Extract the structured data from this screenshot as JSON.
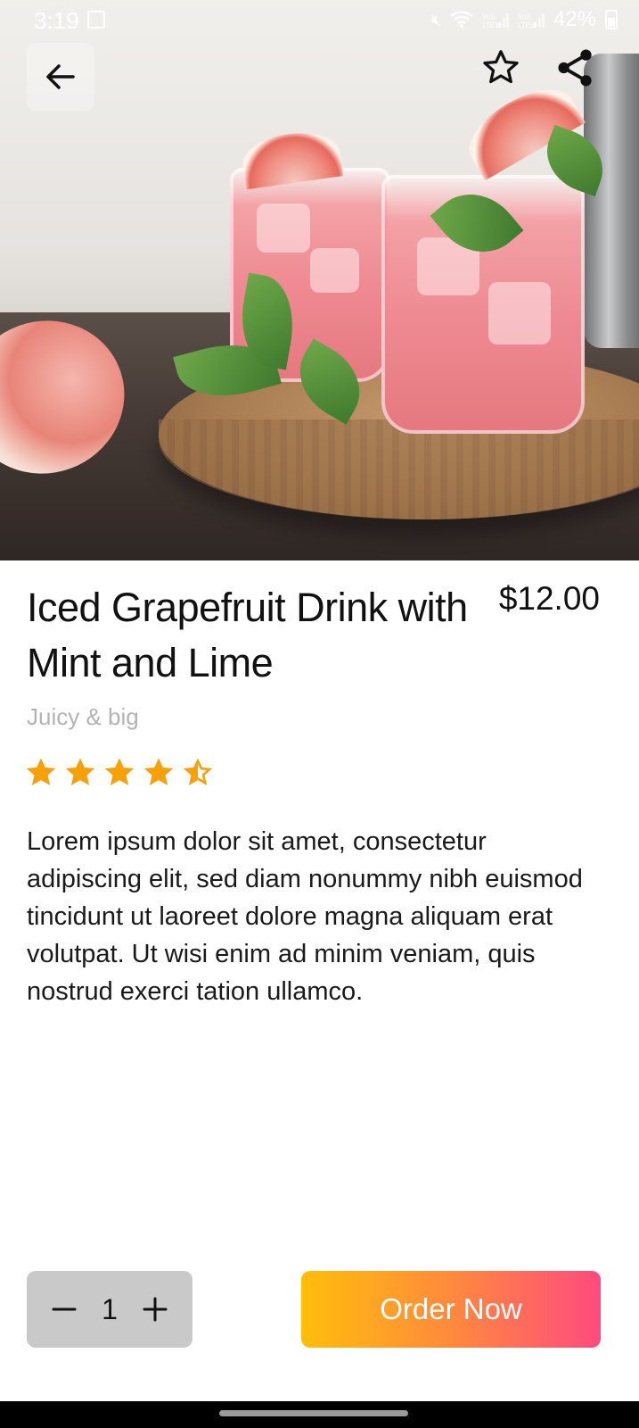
{
  "status_bar": {
    "time": "3:19",
    "battery": "42%",
    "icons": [
      "gallery-icon",
      "mute-icon",
      "wifi-icon",
      "lte1-signal-icon",
      "lte2-signal-icon",
      "battery-icon"
    ]
  },
  "hero": {
    "icons": {
      "back": "arrow-left-icon",
      "favorite": "star-outline-icon",
      "share": "share-icon"
    }
  },
  "product": {
    "title": "Iced Grapefruit Drink with Mint and Lime",
    "price": "$12.00",
    "subtitle": "Juicy & big",
    "rating": 4.5,
    "rating_max": 5,
    "description": "Lorem ipsum dolor sit amet, consectetur adipiscing elit, sed diam nonummy nibh euismod tincidunt ut laoreet dolore magna aliquam erat volutpat. Ut wisi enim ad minim veniam, quis nostrud exerci tation ullamco."
  },
  "order": {
    "quantity": "1",
    "button_label": "Order Now"
  },
  "colors": {
    "star": "#f7a10a",
    "order_gradient_start": "#ffbe0b",
    "order_gradient_end": "#ff4a7f",
    "qty_background": "#c9c9c9"
  }
}
